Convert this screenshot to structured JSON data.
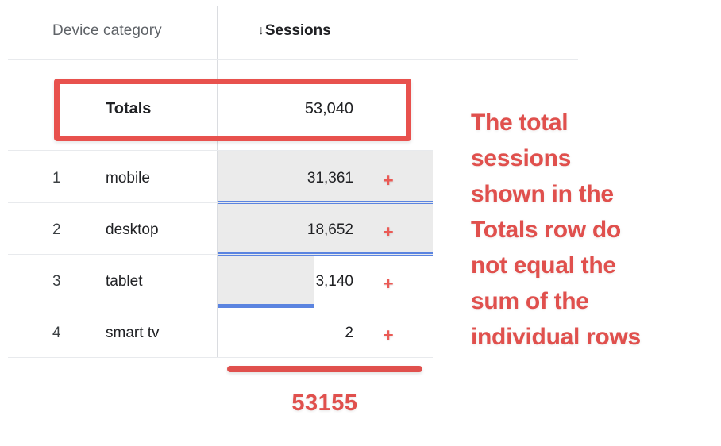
{
  "table": {
    "columns": [
      {
        "id": "dimension",
        "label": "Device category",
        "sort_indicator": ""
      },
      {
        "id": "metric",
        "label": "Sessions",
        "sort_indicator": "↓"
      }
    ],
    "totals_row": {
      "label": "Totals",
      "value": "53,040"
    },
    "rows": [
      {
        "index": "1",
        "label": "mobile",
        "value": "31,361",
        "expand_icon": "+",
        "bar_ratio": 1.0
      },
      {
        "index": "2",
        "label": "desktop",
        "value": "18,652",
        "expand_icon": "+",
        "bar_ratio": 1.0
      },
      {
        "index": "3",
        "label": "tablet",
        "value": "3,140",
        "expand_icon": "+",
        "bar_ratio": 0.444
      },
      {
        "index": "4",
        "label": "smart tv",
        "value": "2",
        "expand_icon": "+",
        "bar_ratio": 0.0
      }
    ]
  },
  "annotations": {
    "callout_lines": [
      "The total",
      "sessions",
      "shown in the",
      "Totals row do",
      "not equal the",
      "sum of the",
      "individual rows"
    ],
    "computed_sum": "53155"
  },
  "colors": {
    "annotation_red": "#e0504d",
    "highlight_box_red": "#e8514d",
    "expand_plus_red": "#ea5a55",
    "bar_blue": "#5b84e0",
    "bar_background_gray": "#ebebeb",
    "header_dimension_gray": "#5f6368",
    "text_primary": "#202124",
    "rule_gray": "#e8eaed"
  }
}
